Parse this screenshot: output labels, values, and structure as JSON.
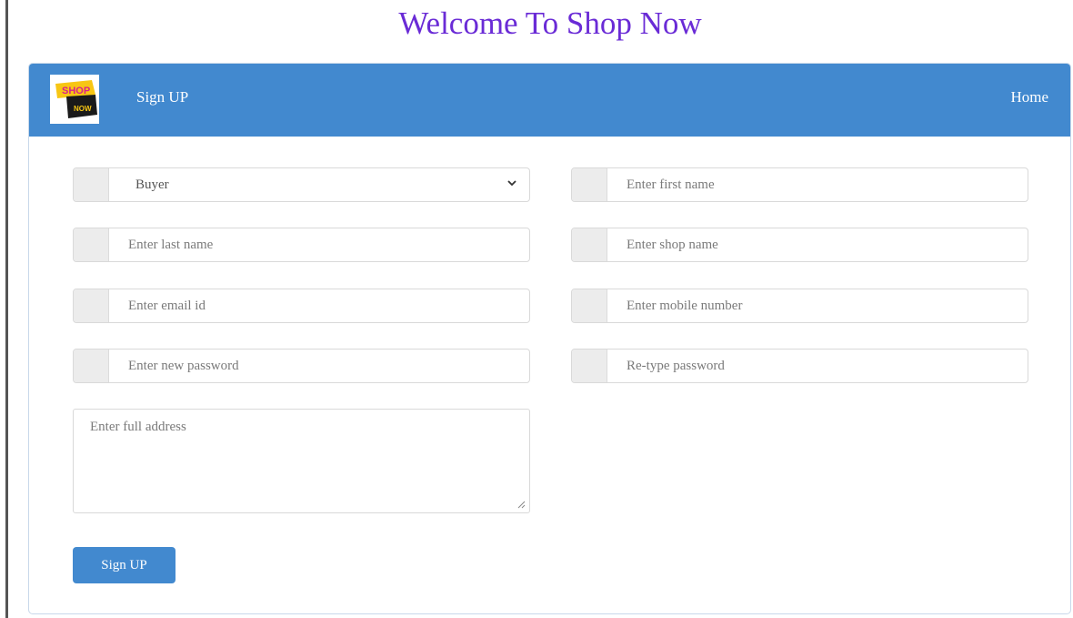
{
  "page_title": "Welcome To Shop Now",
  "navbar": {
    "brand_label": "Sign UP",
    "home_link": "Home",
    "logo_icon": "shop-now-logo",
    "logo_text_top": "SHOP",
    "logo_text_bottom": "NOW"
  },
  "form": {
    "account_type": {
      "value": "Buyer",
      "icon": "chevron-down-icon"
    },
    "first_name": {
      "placeholder": "Enter first name"
    },
    "last_name": {
      "placeholder": "Enter last name"
    },
    "shop_name": {
      "placeholder": "Enter shop name"
    },
    "email": {
      "placeholder": "Enter email id"
    },
    "mobile": {
      "placeholder": "Enter mobile number"
    },
    "new_password": {
      "placeholder": "Enter new password"
    },
    "retype_password": {
      "placeholder": "Re-type password"
    },
    "address": {
      "placeholder": "Enter full address"
    },
    "submit_label": "Sign UP"
  },
  "colors": {
    "title": "#6a2bd6",
    "navbar": "#4289cf",
    "button": "#4289cf"
  }
}
